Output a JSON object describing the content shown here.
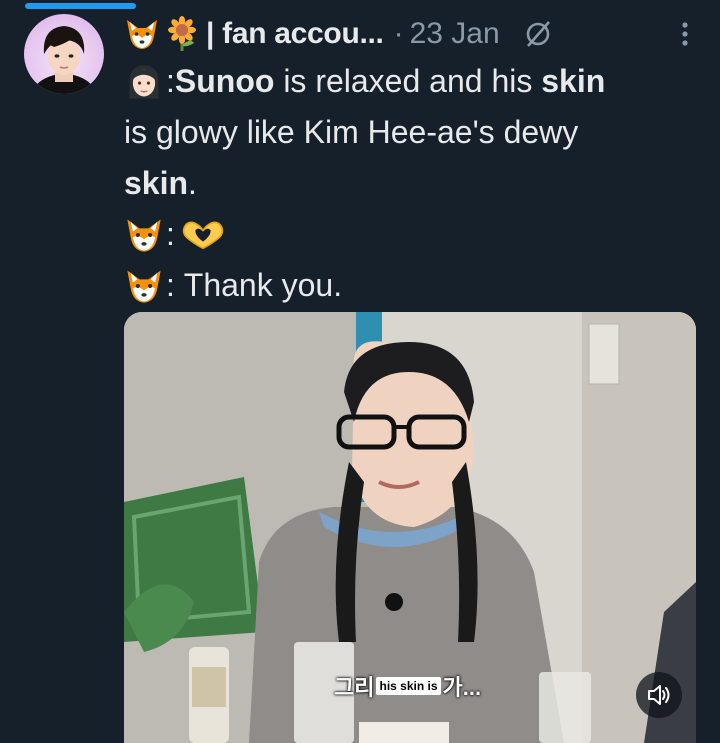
{
  "header": {
    "display_name": "| fan accou...",
    "separator": "·",
    "date": "23 Jan"
  },
  "tweet": {
    "line1_speaker_sep": ": ",
    "line1_bold_a": "Sunoo",
    "line1_text_a": " is relaxed and his ",
    "line1_bold_b": "skin",
    "line2_text": "is glowy like Kim Hee-ae's dewy",
    "line3_bold": "skin",
    "line3_text": ".",
    "line4_sep": ":",
    "line5_sep": ": ",
    "line5_text": "Thank you."
  },
  "media": {
    "subtitle_pre": "그리",
    "subtitle_inner": "his skin is",
    "subtitle_post": "가..."
  },
  "icons": {
    "name_emoji_1": "fox-emoji",
    "name_emoji_2": "sunflower-emoji",
    "speaker_a": "woman-emoji",
    "speaker_b": "fox-emoji",
    "reaction": "heart-hands-emoji",
    "edited": "edited-icon",
    "more": "more-options-icon",
    "mute": "speaker-icon"
  },
  "colors": {
    "background": "#15202b",
    "text": "#e7e9ea",
    "muted_text": "#8b98a5",
    "accent": "#1d9bf0"
  }
}
